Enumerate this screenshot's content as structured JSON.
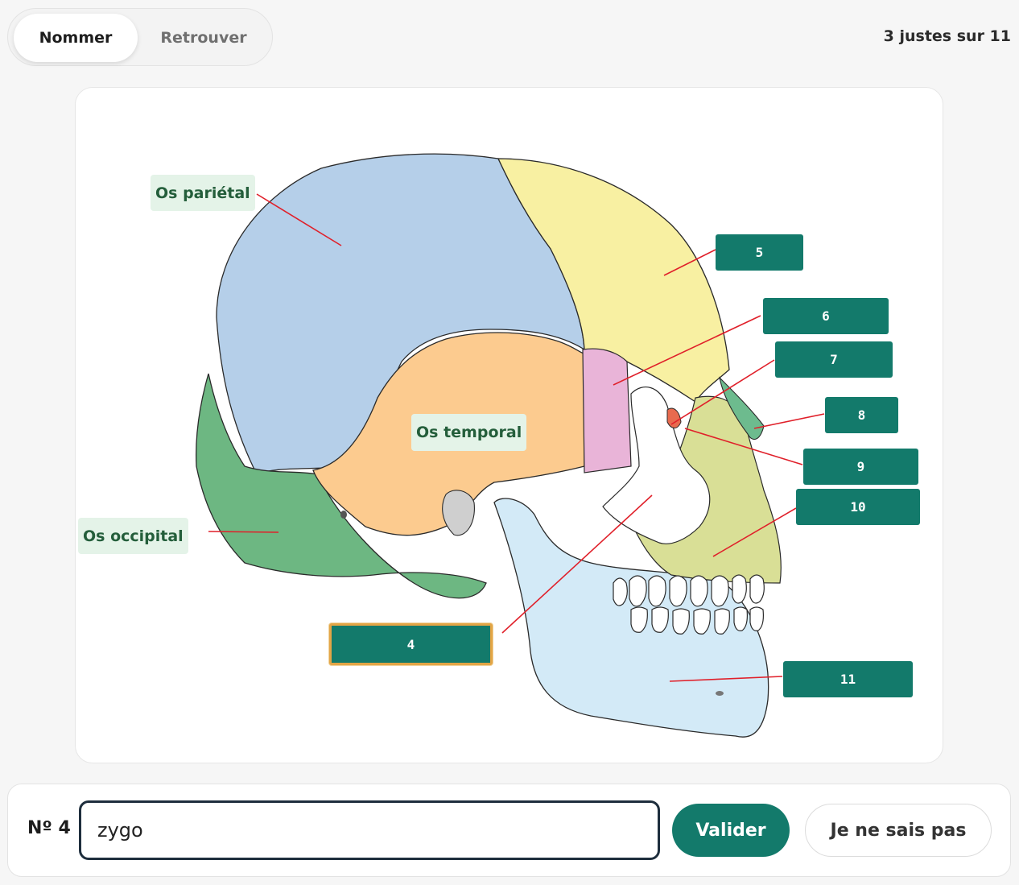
{
  "tabs": [
    {
      "label": "Nommer",
      "active": true
    },
    {
      "label": "Retrouver",
      "active": false
    }
  ],
  "score": "3 justes sur 11",
  "diagram": {
    "known_labels": {
      "parietal": "Os pariétal",
      "temporal": "Os temporal",
      "occipital": "Os occipital"
    },
    "numbered_labels": {
      "n4": "4",
      "n5": "5",
      "n6": "6",
      "n7": "7",
      "n8": "8",
      "n9": "9",
      "n10": "10",
      "n11": "11"
    },
    "active_label": "4",
    "colors": {
      "parietal": "#b5cfe9",
      "frontal": "#f8f0a2",
      "temporal": "#fccb8f",
      "occipital": "#6db782",
      "sphenoid": "#e9b4d8",
      "zygomatic": "#ffffff",
      "maxilla": "#d9df96",
      "mandible": "#d3eaf7",
      "nasal": "#6dbb8e",
      "lacrimal": "#e86a4e",
      "leader_line": "#e0202a",
      "label_bg": "#137a6b",
      "active_border": "#e3a546"
    }
  },
  "answer": {
    "number_label": "Nº 4",
    "input_value": "zygo",
    "validate_label": "Valider",
    "skip_label": "Je ne sais pas"
  }
}
